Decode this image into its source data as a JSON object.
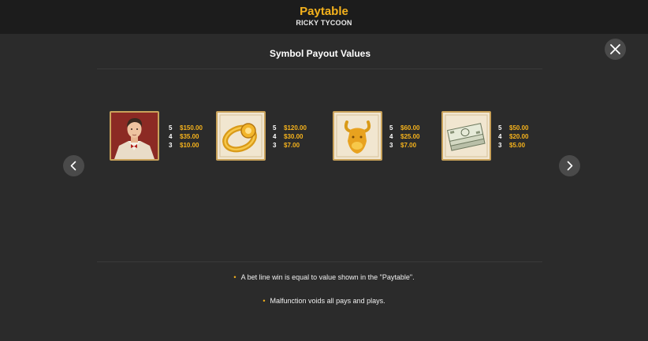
{
  "header": {
    "title": "Paytable",
    "subtitle": "RICKY TYCOON"
  },
  "section": {
    "title": "Symbol Payout Values"
  },
  "symbols": [
    {
      "icon": "tycoon-man-icon",
      "payouts": [
        {
          "count": "5",
          "amount": "$150.00"
        },
        {
          "count": "4",
          "amount": "$35.00"
        },
        {
          "count": "3",
          "amount": "$10.00"
        }
      ]
    },
    {
      "icon": "gold-ring-icon",
      "payouts": [
        {
          "count": "5",
          "amount": "$120.00"
        },
        {
          "count": "4",
          "amount": "$30.00"
        },
        {
          "count": "3",
          "amount": "$7.00"
        }
      ]
    },
    {
      "icon": "golden-bull-icon",
      "payouts": [
        {
          "count": "5",
          "amount": "$60.00"
        },
        {
          "count": "4",
          "amount": "$25.00"
        },
        {
          "count": "3",
          "amount": "$7.00"
        }
      ]
    },
    {
      "icon": "money-stack-icon",
      "payouts": [
        {
          "count": "5",
          "amount": "$50.00"
        },
        {
          "count": "4",
          "amount": "$20.00"
        },
        {
          "count": "3",
          "amount": "$5.00"
        }
      ]
    }
  ],
  "notes": [
    "A bet line win is equal to value shown in the \"Paytable\".",
    "Malfunction voids all pays and plays."
  ],
  "colors": {
    "accent": "#f5b21c",
    "background": "#2b2b2b",
    "header": "#1c1c1c",
    "button": "#4a4a4a"
  }
}
